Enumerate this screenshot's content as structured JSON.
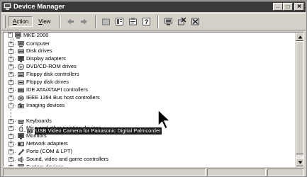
{
  "window": {
    "title": "Device Manager",
    "app_icon": "device-manager-icon",
    "controls": {
      "minimize": "_",
      "maximize": "□",
      "close": "×"
    }
  },
  "menu": [
    {
      "name": "action",
      "label": "Action",
      "underline": "A",
      "rest": "ction"
    },
    {
      "name": "view",
      "label": "View",
      "underline": "V",
      "rest": "iew"
    }
  ],
  "toolbar": {
    "buttons": [
      "back-arrow-icon",
      "forward-arrow-icon",
      "up-folder-icon",
      "show-hide-tree-icon",
      "properties-icon",
      "help-icon",
      "scan-hardware-icon",
      "uninstall-icon",
      "disable-icon"
    ]
  },
  "tree": {
    "root": {
      "label": "MKE-2000",
      "icon": "computer-icon"
    },
    "items": [
      {
        "label": "Computer",
        "icon": "computer-icon",
        "expander": "+"
      },
      {
        "label": "Disk drives",
        "icon": "disk-drive-icon",
        "expander": "+"
      },
      {
        "label": "Display adapters",
        "icon": "display-adapter-icon",
        "expander": "+"
      },
      {
        "label": "DVD/CD-ROM drives",
        "icon": "cdrom-icon",
        "expander": "+"
      },
      {
        "label": "Floppy disk controllers",
        "icon": "floppy-controller-icon",
        "expander": "+"
      },
      {
        "label": "Floppy disk drives",
        "icon": "floppy-drive-icon",
        "expander": "+"
      },
      {
        "label": "IDE ATA/ATAPI controllers",
        "icon": "ide-controller-icon",
        "expander": "+"
      },
      {
        "label": "IEEE 1394 Bus host controllers",
        "icon": "ieee1394-icon",
        "expander": "+"
      },
      {
        "label": "Imaging devices",
        "icon": "imaging-device-icon",
        "expander": "-"
      },
      {
        "label": "Keyboards",
        "icon": "keyboard-icon",
        "expander": "+"
      },
      {
        "label": "Mice and other pointing devices",
        "icon": "mouse-icon",
        "expander": "+"
      },
      {
        "label": "Monitors",
        "icon": "monitor-icon",
        "expander": "+"
      },
      {
        "label": "Network adapters",
        "icon": "network-adapter-icon",
        "expander": "+"
      },
      {
        "label": "Ports (COM & LPT)",
        "icon": "port-icon",
        "expander": "+"
      },
      {
        "label": "Sound, video and game controllers",
        "icon": "sound-icon",
        "expander": "+"
      },
      {
        "label": "System devices",
        "icon": "system-device-icon",
        "expander": "+"
      }
    ],
    "child": {
      "label": "USB Video Camera for Panasonic Digital Palmcorder",
      "icon": "camera-icon",
      "parent": "Imaging devices",
      "selected": true
    }
  },
  "cursor": "mouse-pointer-icon",
  "colors": {
    "titlebar": "#3a3a3a",
    "selection": "#1a1a1a",
    "chrome": "#d4d0c8"
  }
}
